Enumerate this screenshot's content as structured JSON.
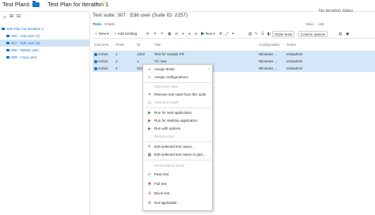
{
  "breadcrumb": {
    "root": "Test Plans",
    "plan": "Test Plan for Iteration 1"
  },
  "header": {
    "iteration_status": "No iteration dates"
  },
  "sidebar": {
    "items": [
      {
        "label": "Test Plan for Iteration 1",
        "selected": false
      },
      {
        "label": "306 : Add user (1)",
        "selected": false
      },
      {
        "label": "307 : Edit user (3)",
        "selected": true
      },
      {
        "label": "308 : Delete user",
        "selected": false
      },
      {
        "label": "309 : Copy user",
        "selected": false
      }
    ]
  },
  "suite": {
    "title": "Test suite: 307 : Edit user (Suite ID: 2257)"
  },
  "tabs": [
    {
      "label": "Tests",
      "active": true
    },
    {
      "label": "Charts",
      "active": false
    }
  ],
  "views": {
    "label": "View:",
    "options": [
      "List"
    ]
  },
  "toolbar": {
    "new_label": "New",
    "add_existing_label": "Add existing",
    "run_label": "Run",
    "order_tests_label": "Order tests",
    "column_options_label": "Column options"
  },
  "grid": {
    "columns": [
      "Outcome",
      "Order",
      "ID",
      "Title",
      "Configuration",
      "Tester"
    ],
    "rows": [
      {
        "outcome": "Active",
        "order": "1",
        "id": "1342",
        "title": "Test for sample FR",
        "configuration": "Windows ...",
        "tester": "vstsadmin"
      },
      {
        "outcome": "Active",
        "order": "2",
        "id": "1",
        "title": "TC new",
        "configuration": "Windows ...",
        "tester": "vstsadmin"
      },
      {
        "outcome": "Active",
        "order": "3",
        "id": "2213",
        "title": "",
        "configuration": "Windows ...",
        "tester": "vstsadmin"
      }
    ]
  },
  "context_menu": {
    "items": [
      {
        "label": "Assign tester",
        "icon": "person-icon",
        "disabled": false,
        "submenu": true
      },
      {
        "label": "Assign configurations",
        "icon": "config-icon",
        "disabled": false
      },
      {
        "label": "Open test case",
        "icon": "",
        "disabled": true
      },
      {
        "label": "Remove test case from this suite",
        "icon": "remove-icon",
        "disabled": false
      },
      {
        "label": "View test result",
        "icon": "",
        "disabled": true
      },
      {
        "label": "Run for web application",
        "icon": "play-icon",
        "disabled": false
      },
      {
        "label": "Run for desktop application",
        "icon": "play-icon",
        "disabled": false
      },
      {
        "label": "Run with options",
        "icon": "play-icon",
        "disabled": false
      },
      {
        "label": "Resume test",
        "icon": "",
        "disabled": true
      },
      {
        "label": "Edit selected test cases...",
        "icon": "edit-icon",
        "disabled": false
      },
      {
        "label": "Edit selected test cases in grid...",
        "icon": "grid-edit-icon",
        "disabled": false
      },
      {
        "label": "Reset test to active",
        "icon": "",
        "disabled": true
      },
      {
        "label": "Pass test",
        "icon": "pass-icon",
        "disabled": false
      },
      {
        "label": "Fail test",
        "icon": "fail-icon",
        "disabled": false
      },
      {
        "label": "Block test",
        "icon": "block-icon",
        "disabled": false
      },
      {
        "label": "Not applicable",
        "icon": "na-icon",
        "disabled": false
      }
    ]
  },
  "colors": {
    "accent": "#1a73c7",
    "pass": "#2e9b2e",
    "fail": "#d93025",
    "selection": "#d4e6f7"
  }
}
